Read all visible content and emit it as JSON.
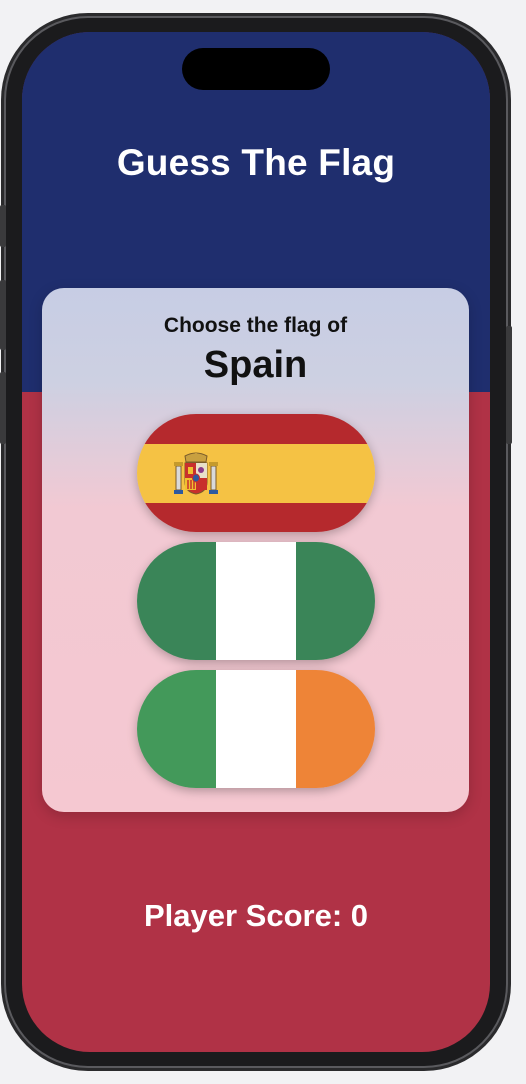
{
  "app": {
    "title": "Guess The Flag",
    "prompt": "Choose the flag of",
    "country": "Spain",
    "score_label": "Player Score: 0"
  },
  "flags": [
    {
      "id": "spain",
      "colors": [
        "#b5292d",
        "#f5c244",
        "#b5292d"
      ],
      "orientation": "horizontal",
      "emblem": "coat-of-arms-icon"
    },
    {
      "id": "nigeria",
      "colors": [
        "#3a8558",
        "#ffffff",
        "#3a8558"
      ],
      "orientation": "vertical"
    },
    {
      "id": "ireland",
      "colors": [
        "#43995a",
        "#ffffff",
        "#ee8437"
      ],
      "orientation": "vertical"
    }
  ],
  "theme": {
    "top_color": "#1f2e6e",
    "bottom_color": "#b03246",
    "card_color": "#f5c8d1"
  }
}
